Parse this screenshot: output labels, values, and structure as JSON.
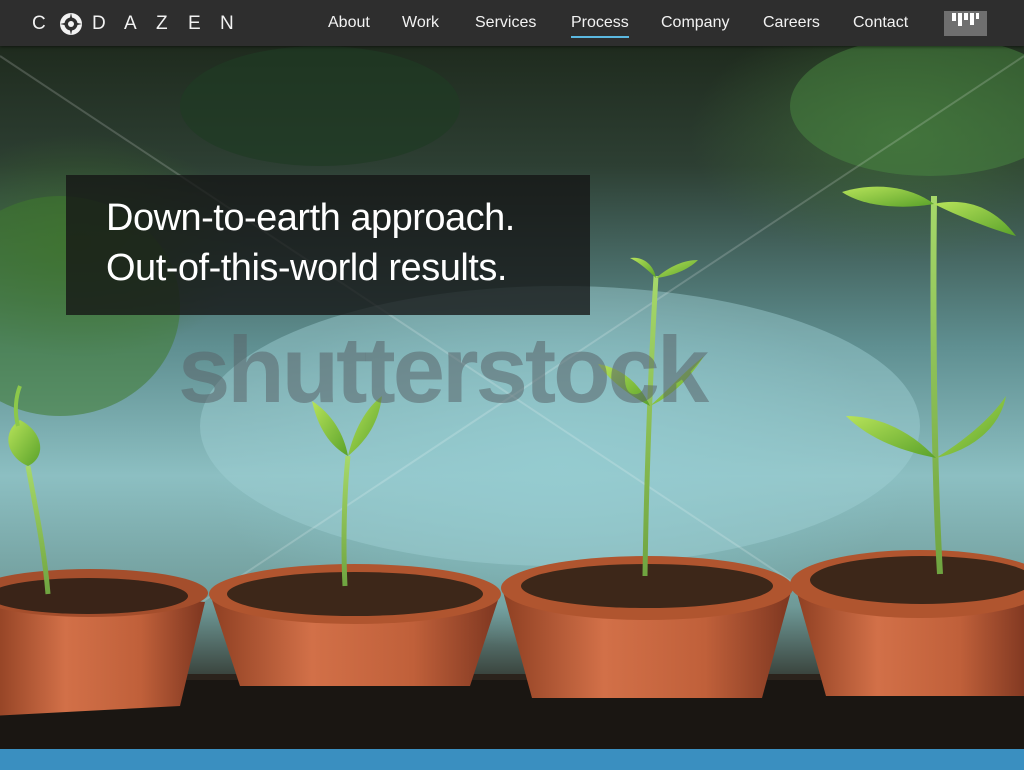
{
  "brand": {
    "letters": [
      "C",
      "D",
      "A",
      "Z",
      "E",
      "N"
    ],
    "logo_icon": "codazen-compass-mark-icon"
  },
  "nav": {
    "items": [
      {
        "label": "About",
        "active": false
      },
      {
        "label": "Work",
        "active": false
      },
      {
        "label": "Services",
        "active": false
      },
      {
        "label": "Process",
        "active": true
      },
      {
        "label": "Company",
        "active": false
      },
      {
        "label": "Careers",
        "active": false
      },
      {
        "label": "Contact",
        "active": false
      }
    ],
    "badge_icon": "partner-badge-icon"
  },
  "hero": {
    "headline_line1": "Down-to-earth approach.",
    "headline_line2": "Out-of-this-world results.",
    "watermark": "shutterstock",
    "image_subject": "seedlings-in-clay-pots"
  },
  "colors": {
    "nav_bg": "#2e2e2e",
    "active_underline": "#5bb8e0",
    "bottom_strip": "#3a8fc0",
    "pot": "#c8643a"
  }
}
